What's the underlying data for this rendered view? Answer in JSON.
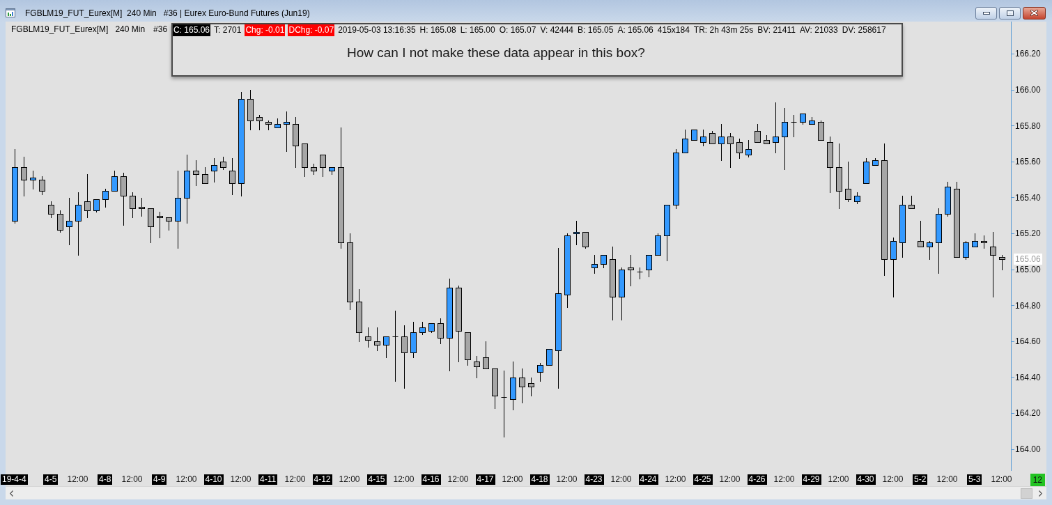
{
  "window": {
    "title": "FGBLM19_FUT_Eurex[M]  240 Min   #36 | Eurex Euro-Bund Futures (Jun19)"
  },
  "chart": {
    "header": {
      "symbol": "FGBLM19_FUT_Eurex[M]",
      "interval": "240 Min",
      "bar_number": "#36"
    },
    "data_box": {
      "fields": [
        {
          "text": "C: 165.06",
          "color": "#000000"
        },
        {
          "text": "T: 2701"
        },
        {
          "text": "Chg: -0.01",
          "color": "#ff0000"
        },
        {
          "text": "DChg: -0.07",
          "color": "#ff0000"
        },
        {
          "text": "2019-05-03 13:16:35"
        },
        {
          "text": "H: 165.08"
        },
        {
          "text": "L: 165.00"
        },
        {
          "text": "O: 165.07"
        },
        {
          "text": "V: 42444"
        },
        {
          "text": "B: 165.05"
        },
        {
          "text": "A: 165.06"
        },
        {
          "text": "415x184"
        },
        {
          "text": "TR: 2h 43m 25s"
        },
        {
          "text": "BV: 21411"
        },
        {
          "text": "AV: 21033"
        },
        {
          "text": "DV: 258617"
        }
      ],
      "note": "How can I not make these data appear in this box?"
    },
    "chart_data": {
      "type": "candlestick",
      "ylim": [
        163.88,
        166.38
      ],
      "yticks": [
        {
          "value": 166.2,
          "label": "166.20"
        },
        {
          "value": 166.0,
          "label": "166.00"
        },
        {
          "value": 165.8,
          "label": "165.80"
        },
        {
          "value": 165.6,
          "label": "165.60"
        },
        {
          "value": 165.4,
          "label": "165.40"
        },
        {
          "value": 165.2,
          "label": "165.20"
        },
        {
          "value": 165.0,
          "label": "165.00"
        },
        {
          "value": 164.8,
          "label": "164.80"
        },
        {
          "value": 164.6,
          "label": "164.60"
        },
        {
          "value": 164.4,
          "label": "164.40"
        },
        {
          "value": 164.2,
          "label": "164.20"
        },
        {
          "value": 164.0,
          "label": "164.00"
        }
      ],
      "categories": [
        "19-4-4",
        null,
        null,
        null,
        "4-5",
        null,
        null,
        "12:00",
        null,
        null,
        "4-8",
        null,
        null,
        "12:00",
        null,
        null,
        "4-9",
        null,
        null,
        "12:00",
        null,
        null,
        "4-10",
        null,
        null,
        "12:00",
        null,
        null,
        "4-11",
        null,
        null,
        "12:00",
        null,
        null,
        "4-12",
        null,
        null,
        "12:00",
        null,
        null,
        "4-15",
        null,
        null,
        "12:00",
        null,
        null,
        "4-16",
        null,
        null,
        "12:00",
        null,
        null,
        "4-17",
        null,
        null,
        "12:00",
        null,
        null,
        "4-18",
        null,
        null,
        "12:00",
        null,
        null,
        "4-23",
        null,
        null,
        "12:00",
        null,
        null,
        "4-24",
        null,
        null,
        "12:00",
        null,
        null,
        "4-25",
        null,
        null,
        "12:00",
        null,
        null,
        "4-26",
        null,
        null,
        "12:00",
        null,
        null,
        "4-29",
        null,
        null,
        "12:00",
        null,
        null,
        "4-30",
        null,
        null,
        "12:00",
        null,
        null,
        "5-2",
        null,
        null,
        "12:00",
        null,
        null,
        "5-3",
        null,
        null,
        "12:00"
      ],
      "ohlc": [
        [
          165.27,
          165.67,
          165.26,
          165.57
        ],
        [
          165.57,
          165.63,
          165.41,
          165.5
        ],
        [
          165.5,
          165.55,
          165.45,
          165.51
        ],
        [
          165.5,
          165.52,
          165.42,
          165.44
        ],
        [
          165.36,
          165.38,
          165.29,
          165.31
        ],
        [
          165.31,
          165.33,
          165.21,
          165.22
        ],
        [
          165.24,
          165.4,
          165.14,
          165.27
        ],
        [
          165.27,
          165.43,
          165.08,
          165.36
        ],
        [
          165.38,
          165.53,
          165.29,
          165.33
        ],
        [
          165.33,
          165.39,
          165.32,
          165.39
        ],
        [
          165.39,
          165.45,
          165.35,
          165.44
        ],
        [
          165.44,
          165.55,
          165.44,
          165.52
        ],
        [
          165.52,
          165.54,
          165.25,
          165.41
        ],
        [
          165.41,
          165.43,
          165.29,
          165.34
        ],
        [
          165.35,
          165.4,
          165.3,
          165.34
        ],
        [
          165.34,
          165.34,
          165.15,
          165.24
        ],
        [
          165.3,
          165.32,
          165.18,
          165.29
        ],
        [
          165.29,
          165.29,
          165.22,
          165.27
        ],
        [
          165.27,
          165.55,
          165.12,
          165.4
        ],
        [
          165.4,
          165.64,
          165.26,
          165.55
        ],
        [
          165.55,
          165.61,
          165.47,
          165.53
        ],
        [
          165.53,
          165.57,
          165.48,
          165.48
        ],
        [
          165.55,
          165.62,
          165.49,
          165.58
        ],
        [
          165.6,
          165.63,
          165.56,
          165.57
        ],
        [
          165.55,
          165.62,
          165.42,
          165.48
        ],
        [
          165.48,
          165.99,
          165.41,
          165.95
        ],
        [
          165.95,
          166.0,
          165.78,
          165.83
        ],
        [
          165.85,
          165.86,
          165.78,
          165.83
        ],
        [
          165.82,
          165.83,
          165.78,
          165.81
        ],
        [
          165.79,
          165.84,
          165.79,
          165.81
        ],
        [
          165.81,
          165.88,
          165.66,
          165.82
        ],
        [
          165.81,
          165.85,
          165.57,
          165.69
        ],
        [
          165.7,
          165.7,
          165.52,
          165.57
        ],
        [
          165.57,
          165.59,
          165.53,
          165.55
        ],
        [
          165.64,
          165.64,
          165.52,
          165.57
        ],
        [
          165.55,
          165.57,
          165.53,
          165.57
        ],
        [
          165.57,
          165.79,
          165.12,
          165.15
        ],
        [
          165.15,
          165.2,
          164.78,
          164.82
        ],
        [
          164.82,
          164.89,
          164.6,
          164.65
        ],
        [
          164.63,
          164.68,
          164.57,
          164.61
        ],
        [
          164.6,
          164.68,
          164.55,
          164.58
        ],
        [
          164.58,
          164.63,
          164.51,
          164.63
        ],
        [
          164.63,
          164.77,
          164.38,
          164.63
        ],
        [
          164.63,
          164.69,
          164.34,
          164.54
        ],
        [
          164.54,
          164.71,
          164.51,
          164.65
        ],
        [
          164.65,
          164.71,
          164.64,
          164.68
        ],
        [
          164.66,
          164.7,
          164.65,
          164.7
        ],
        [
          164.7,
          164.73,
          164.59,
          164.62
        ],
        [
          164.62,
          164.95,
          164.44,
          164.9
        ],
        [
          164.9,
          164.91,
          164.49,
          164.66
        ],
        [
          164.65,
          164.65,
          164.47,
          164.5
        ],
        [
          164.49,
          164.52,
          164.4,
          164.46
        ],
        [
          164.51,
          164.6,
          164.45,
          164.45
        ],
        [
          164.45,
          164.45,
          164.23,
          164.3
        ],
        [
          164.29,
          164.44,
          164.07,
          164.29
        ],
        [
          164.28,
          164.49,
          164.22,
          164.4
        ],
        [
          164.4,
          164.45,
          164.26,
          164.35
        ],
        [
          164.37,
          164.4,
          164.3,
          164.35
        ],
        [
          164.43,
          164.48,
          164.38,
          164.47
        ],
        [
          164.47,
          164.56,
          164.47,
          164.56
        ],
        [
          164.55,
          165.12,
          164.34,
          164.87
        ],
        [
          164.86,
          165.2,
          164.79,
          165.19
        ],
        [
          165.2,
          165.27,
          165.14,
          165.21
        ],
        [
          165.21,
          165.21,
          165.12,
          165.13
        ],
        [
          165.01,
          165.08,
          164.98,
          165.03
        ],
        [
          165.03,
          165.08,
          165.01,
          165.08
        ],
        [
          165.06,
          165.13,
          164.72,
          164.85
        ],
        [
          164.85,
          165.01,
          164.72,
          165.0
        ],
        [
          165.01,
          165.08,
          164.91,
          165.0
        ],
        [
          164.99,
          165.01,
          164.95,
          164.99
        ],
        [
          165.0,
          165.08,
          164.96,
          165.08
        ],
        [
          165.08,
          165.2,
          165.08,
          165.19
        ],
        [
          165.19,
          165.36,
          165.05,
          165.36
        ],
        [
          165.36,
          165.67,
          165.34,
          165.65
        ],
        [
          165.65,
          165.78,
          165.65,
          165.73
        ],
        [
          165.72,
          165.78,
          165.72,
          165.78
        ],
        [
          165.71,
          165.78,
          165.69,
          165.74
        ],
        [
          165.76,
          165.77,
          165.7,
          165.7
        ],
        [
          165.7,
          165.81,
          165.61,
          165.74
        ],
        [
          165.74,
          165.76,
          165.57,
          165.7
        ],
        [
          165.71,
          165.73,
          165.62,
          165.65
        ],
        [
          165.64,
          165.72,
          165.63,
          165.67
        ],
        [
          165.77,
          165.81,
          165.71,
          165.71
        ],
        [
          165.72,
          165.75,
          165.7,
          165.7
        ],
        [
          165.71,
          165.93,
          165.65,
          165.74
        ],
        [
          165.74,
          165.9,
          165.56,
          165.82
        ],
        [
          165.82,
          165.86,
          165.74,
          165.82
        ],
        [
          165.82,
          165.87,
          165.81,
          165.87
        ],
        [
          165.81,
          165.85,
          165.81,
          165.83
        ],
        [
          165.82,
          165.83,
          165.72,
          165.72
        ],
        [
          165.71,
          165.74,
          165.43,
          165.57
        ],
        [
          165.57,
          165.7,
          165.34,
          165.44
        ],
        [
          165.45,
          165.6,
          165.38,
          165.39
        ],
        [
          165.38,
          165.43,
          165.37,
          165.41
        ],
        [
          165.48,
          165.62,
          165.48,
          165.6
        ],
        [
          165.58,
          165.62,
          165.58,
          165.61
        ],
        [
          165.61,
          165.7,
          164.97,
          165.06
        ],
        [
          165.06,
          165.18,
          164.85,
          165.16
        ],
        [
          165.15,
          165.41,
          165.07,
          165.36
        ],
        [
          165.36,
          165.41,
          165.34,
          165.34
        ],
        [
          165.16,
          165.27,
          165.13,
          165.13
        ],
        [
          165.13,
          165.16,
          165.06,
          165.15
        ],
        [
          165.15,
          165.34,
          164.98,
          165.31
        ],
        [
          165.31,
          165.49,
          165.3,
          165.46
        ],
        [
          165.45,
          165.49,
          165.07,
          165.07
        ],
        [
          165.07,
          165.16,
          165.06,
          165.15
        ],
        [
          165.13,
          165.2,
          165.13,
          165.16
        ],
        [
          165.16,
          165.19,
          165.12,
          165.15
        ],
        [
          165.13,
          165.21,
          164.85,
          165.08
        ],
        [
          165.07,
          165.08,
          165.0,
          165.06
        ]
      ]
    },
    "x_label_states": [
      {
        "highlighted": true
      },
      {
        "highlighted": true
      },
      {
        "highlighted": false
      },
      {
        "highlighted": true
      },
      {
        "highlighted": false
      },
      {
        "highlighted": true
      },
      {
        "highlighted": false
      },
      {
        "highlighted": true
      },
      {
        "highlighted": false
      },
      {
        "highlighted": true
      },
      {
        "highlighted": false
      },
      {
        "highlighted": true
      },
      {
        "highlighted": false
      },
      {
        "highlighted": true
      },
      {
        "highlighted": false
      },
      {
        "highlighted": true
      },
      {
        "highlighted": false
      },
      {
        "highlighted": true
      },
      {
        "highlighted": false
      },
      {
        "highlighted": true
      },
      {
        "highlighted": false
      },
      {
        "highlighted": true
      },
      {
        "highlighted": false
      },
      {
        "highlighted": true
      },
      {
        "highlighted": false
      },
      {
        "highlighted": true
      },
      {
        "highlighted": false
      },
      {
        "highlighted": true
      },
      {
        "highlighted": false
      },
      {
        "highlighted": true
      },
      {
        "highlighted": false
      },
      {
        "highlighted": true
      },
      {
        "highlighted": false
      },
      {
        "highlighted": true
      },
      {
        "highlighted": false
      },
      {
        "highlighted": true
      },
      {
        "highlighted": false
      }
    ],
    "current_price": "165.06",
    "bar_counter": "12"
  }
}
